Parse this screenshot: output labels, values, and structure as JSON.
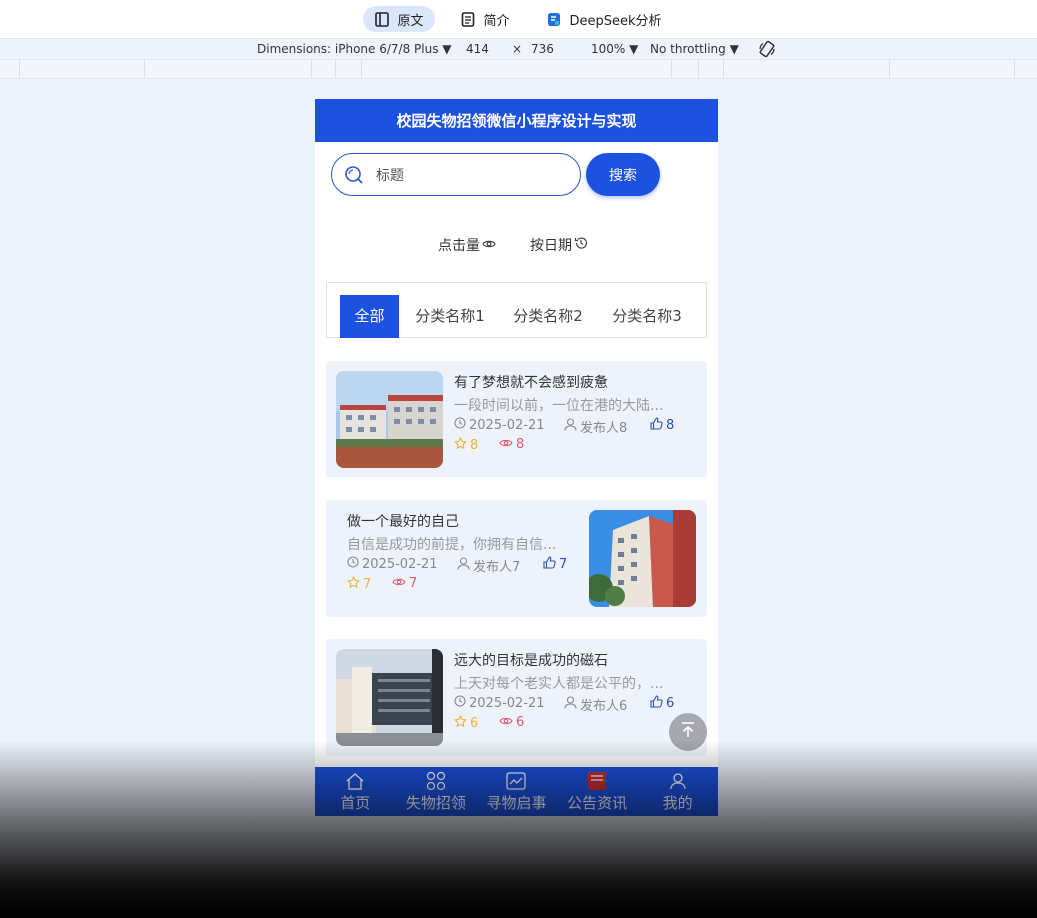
{
  "top_tabs": [
    {
      "label": "原文",
      "icon": "book-icon"
    },
    {
      "label": "简介",
      "icon": "document-icon"
    },
    {
      "label": "DeepSeek分析",
      "icon": "deepseek-icon"
    }
  ],
  "devtools": {
    "dimensions": "Dimensions: iPhone 6/7/8 Plus ▼",
    "width": "414",
    "times": "×",
    "height": "736",
    "zoom": "100% ▼",
    "throttling": "No throttling ▼"
  },
  "app": {
    "header_title": "校园失物招领微信小程序设计与实现",
    "search": {
      "placeholder": "标题",
      "button": "搜索"
    },
    "sort": {
      "clicks": "点击量",
      "date": "按日期"
    },
    "categories": [
      "全部",
      "分类名称1",
      "分类名称2",
      "分类名称3"
    ],
    "posts": [
      {
        "title": "有了梦想就不会感到疲惫",
        "desc": "一段时间以前，一位在港的大陆...",
        "date": "2025-02-21",
        "author": "发布人8",
        "likes": "8",
        "favorites": "8",
        "views": "8"
      },
      {
        "title": "做一个最好的自己",
        "desc": "自信是成功的前提，你拥有自信...",
        "date": "2025-02-21",
        "author": "发布人7",
        "likes": "7",
        "favorites": "7",
        "views": "7"
      },
      {
        "title": "远大的目标是成功的磁石",
        "desc": "上天对每个老实人都是公平的，...",
        "date": "2025-02-21",
        "author": "发布人6",
        "likes": "6",
        "favorites": "6",
        "views": "6"
      }
    ],
    "tabbar": [
      {
        "label": "首页",
        "icon": "home-icon"
      },
      {
        "label": "失物招领",
        "icon": "grid-icon"
      },
      {
        "label": "寻物启事",
        "icon": "notice-board-icon"
      },
      {
        "label": "公告资讯",
        "icon": "news-icon"
      },
      {
        "label": "我的",
        "icon": "user-icon"
      }
    ]
  },
  "colors": {
    "primary": "#1d52e0",
    "card_bg": "#eef3fb",
    "like": "#2851b8",
    "favorite": "#e9b53a",
    "views": "#e05a6a"
  }
}
